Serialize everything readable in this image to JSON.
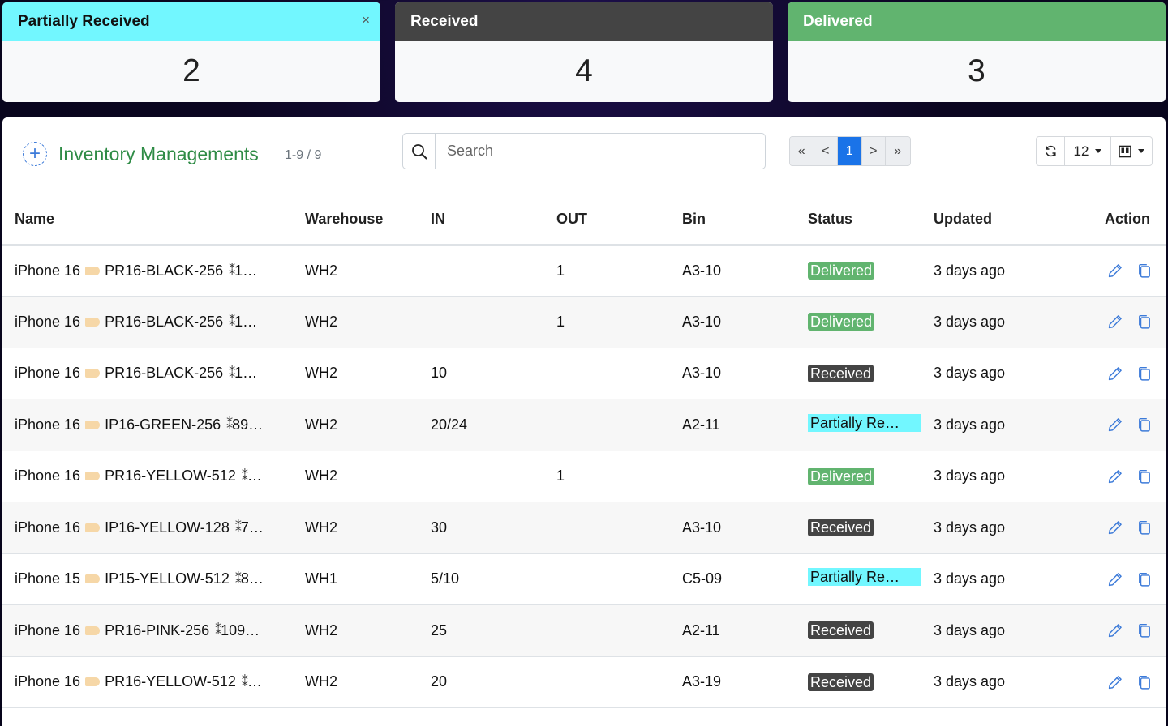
{
  "summary": {
    "partial": {
      "label": "Partially Received",
      "count": "2",
      "close": "×"
    },
    "received": {
      "label": "Received",
      "count": "4"
    },
    "delivered": {
      "label": "Delivered",
      "count": "3"
    }
  },
  "toolbar": {
    "add_label": "+",
    "title": "Inventory Managements",
    "range": "1-9 / 9",
    "search_placeholder": "Search",
    "pager": {
      "first": "«",
      "prev": "<",
      "current": "1",
      "next": ">",
      "last": "»"
    },
    "page_size": "12"
  },
  "columns": {
    "name": "Name",
    "warehouse": "Warehouse",
    "in": "IN",
    "out": "OUT",
    "bin": "Bin",
    "status": "Status",
    "updated": "Updated",
    "action": "Action"
  },
  "rows": [
    {
      "model": "iPhone 16",
      "sku": "PR16-BLACK-256",
      "code": "1…",
      "warehouse": "WH2",
      "in": "",
      "out": "1",
      "bin": "A3-10",
      "status": "Delivered",
      "status_type": "delivered",
      "updated": "3 days ago"
    },
    {
      "model": "iPhone 16",
      "sku": "PR16-BLACK-256",
      "code": "1…",
      "warehouse": "WH2",
      "in": "",
      "out": "1",
      "bin": "A3-10",
      "status": "Delivered",
      "status_type": "delivered",
      "updated": "3 days ago"
    },
    {
      "model": "iPhone 16",
      "sku": "PR16-BLACK-256",
      "code": "1…",
      "warehouse": "WH2",
      "in": "10",
      "out": "",
      "bin": "A3-10",
      "status": "Received",
      "status_type": "received",
      "updated": "3 days ago"
    },
    {
      "model": "iPhone 16",
      "sku": "IP16-GREEN-256",
      "code": "89…",
      "warehouse": "WH2",
      "in": "20/24",
      "out": "",
      "bin": "A2-11",
      "status": "Partially Re…",
      "status_type": "partial",
      "updated": "3 days ago"
    },
    {
      "model": "iPhone 16",
      "sku": "PR16-YELLOW-512",
      "code": "…",
      "warehouse": "WH2",
      "in": "",
      "out": "1",
      "bin": "",
      "status": "Delivered",
      "status_type": "delivered",
      "updated": "3 days ago"
    },
    {
      "model": "iPhone 16",
      "sku": "IP16-YELLOW-128",
      "code": "7…",
      "warehouse": "WH2",
      "in": "30",
      "out": "",
      "bin": "A3-10",
      "status": "Received",
      "status_type": "received",
      "updated": "3 days ago"
    },
    {
      "model": "iPhone 15",
      "sku": "IP15-YELLOW-512",
      "code": "8…",
      "warehouse": "WH1",
      "in": "5/10",
      "out": "",
      "bin": "C5-09",
      "status": "Partially Re…",
      "status_type": "partial",
      "updated": "3 days ago"
    },
    {
      "model": "iPhone 16",
      "sku": "PR16-PINK-256",
      "code": "109…",
      "warehouse": "WH2",
      "in": "25",
      "out": "",
      "bin": "A2-11",
      "status": "Received",
      "status_type": "received",
      "updated": "3 days ago"
    },
    {
      "model": "iPhone 16",
      "sku": "PR16-YELLOW-512",
      "code": "…",
      "warehouse": "WH2",
      "in": "20",
      "out": "",
      "bin": "A3-19",
      "status": "Received",
      "status_type": "received",
      "updated": "3 days ago"
    }
  ],
  "icons": {
    "add": "plus-circle-icon",
    "search": "search-icon",
    "refresh": "refresh-icon",
    "columns": "columns-icon",
    "edit": "pencil-icon",
    "copy": "copy-icon",
    "tag": "tag-icon",
    "barcode": "barcode-icon"
  },
  "colors": {
    "partial": "#72f7ff",
    "received": "#444444",
    "delivered": "#61b46f",
    "title": "#2e8b45",
    "accent": "#1a73e8"
  }
}
